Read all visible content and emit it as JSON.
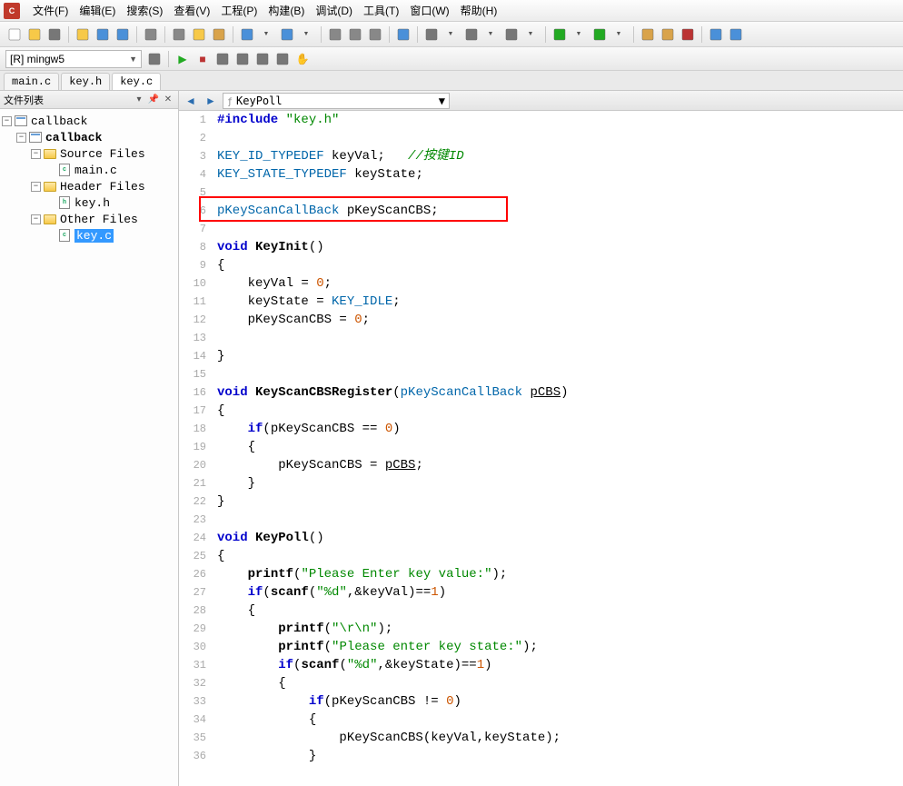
{
  "menu": {
    "items": [
      "文件(F)",
      "编辑(E)",
      "搜索(S)",
      "查看(V)",
      "工程(P)",
      "构建(B)",
      "调试(D)",
      "工具(T)",
      "窗口(W)",
      "帮助(H)"
    ]
  },
  "config_combo": "[R] mingw5",
  "file_tabs": [
    {
      "label": "main.c",
      "active": false
    },
    {
      "label": "key.h",
      "active": false
    },
    {
      "label": "key.c",
      "active": true
    }
  ],
  "side_panel_title": "文件列表",
  "tree": {
    "root": "callback",
    "project": "callback",
    "folders": [
      {
        "name": "Source Files",
        "files": [
          {
            "name": "main.c",
            "ext": "c"
          }
        ]
      },
      {
        "name": "Header Files",
        "files": [
          {
            "name": "key.h",
            "ext": "h"
          }
        ]
      },
      {
        "name": "Other Files",
        "files": [
          {
            "name": "key.c",
            "ext": "c",
            "selected": true
          }
        ]
      }
    ]
  },
  "function_combo": "KeyPoll",
  "highlight_line": 6,
  "code_lines": [
    {
      "n": 1,
      "seg": [
        {
          "t": "#include ",
          "c": "kw"
        },
        {
          "t": "\"key.h\"",
          "c": "str"
        }
      ]
    },
    {
      "n": 2,
      "seg": []
    },
    {
      "n": 3,
      "seg": [
        {
          "t": "KEY_ID_TYPEDEF",
          "c": "ty"
        },
        {
          "t": " keyVal;   ",
          "c": "op"
        },
        {
          "t": "//按键ID",
          "c": "cm"
        }
      ]
    },
    {
      "n": 4,
      "seg": [
        {
          "t": "KEY_STATE_TYPEDEF",
          "c": "ty"
        },
        {
          "t": " keyState;",
          "c": "op"
        }
      ]
    },
    {
      "n": 5,
      "seg": []
    },
    {
      "n": 6,
      "seg": [
        {
          "t": "pKeyScanCallBack",
          "c": "ty"
        },
        {
          "t": " pKeyScanCBS;",
          "c": "op"
        }
      ]
    },
    {
      "n": 7,
      "seg": []
    },
    {
      "n": 8,
      "seg": [
        {
          "t": "void ",
          "c": "kw"
        },
        {
          "t": "KeyInit",
          "c": "fn"
        },
        {
          "t": "()",
          "c": "op"
        }
      ]
    },
    {
      "n": 9,
      "seg": [
        {
          "t": "{",
          "c": "op"
        }
      ]
    },
    {
      "n": 10,
      "seg": [
        {
          "t": "    keyVal = ",
          "c": "op"
        },
        {
          "t": "0",
          "c": "num"
        },
        {
          "t": ";",
          "c": "op"
        }
      ]
    },
    {
      "n": 11,
      "seg": [
        {
          "t": "    keyState = ",
          "c": "op"
        },
        {
          "t": "KEY_IDLE",
          "c": "ty"
        },
        {
          "t": ";",
          "c": "op"
        }
      ]
    },
    {
      "n": 12,
      "seg": [
        {
          "t": "    pKeyScanCBS = ",
          "c": "op"
        },
        {
          "t": "0",
          "c": "num"
        },
        {
          "t": ";",
          "c": "op"
        }
      ]
    },
    {
      "n": 13,
      "seg": []
    },
    {
      "n": 14,
      "seg": [
        {
          "t": "}",
          "c": "op"
        }
      ]
    },
    {
      "n": 15,
      "seg": []
    },
    {
      "n": 16,
      "seg": [
        {
          "t": "void ",
          "c": "kw"
        },
        {
          "t": "KeyScanCBSRegister",
          "c": "fn"
        },
        {
          "t": "(",
          "c": "op"
        },
        {
          "t": "pKeyScanCallBack",
          "c": "ty"
        },
        {
          "t": " ",
          "c": "op"
        },
        {
          "t": "pCBS",
          "c": "und"
        },
        {
          "t": ")",
          "c": "op"
        }
      ]
    },
    {
      "n": 17,
      "seg": [
        {
          "t": "{",
          "c": "op"
        }
      ]
    },
    {
      "n": 18,
      "seg": [
        {
          "t": "    ",
          "c": "op"
        },
        {
          "t": "if",
          "c": "kw"
        },
        {
          "t": "(pKeyScanCBS == ",
          "c": "op"
        },
        {
          "t": "0",
          "c": "num"
        },
        {
          "t": ")",
          "c": "op"
        }
      ]
    },
    {
      "n": 19,
      "seg": [
        {
          "t": "    {",
          "c": "op"
        }
      ]
    },
    {
      "n": 20,
      "seg": [
        {
          "t": "        pKeyScanCBS = ",
          "c": "op"
        },
        {
          "t": "pCBS",
          "c": "und"
        },
        {
          "t": ";",
          "c": "op"
        }
      ]
    },
    {
      "n": 21,
      "seg": [
        {
          "t": "    }",
          "c": "op"
        }
      ]
    },
    {
      "n": 22,
      "seg": [
        {
          "t": "}",
          "c": "op"
        }
      ]
    },
    {
      "n": 23,
      "seg": []
    },
    {
      "n": 24,
      "seg": [
        {
          "t": "void ",
          "c": "kw"
        },
        {
          "t": "KeyPoll",
          "c": "fn"
        },
        {
          "t": "()",
          "c": "op"
        }
      ]
    },
    {
      "n": 25,
      "seg": [
        {
          "t": "{",
          "c": "op"
        }
      ]
    },
    {
      "n": 26,
      "seg": [
        {
          "t": "    ",
          "c": "op"
        },
        {
          "t": "printf",
          "c": "fn"
        },
        {
          "t": "(",
          "c": "op"
        },
        {
          "t": "\"Please Enter key value:\"",
          "c": "str"
        },
        {
          "t": ");",
          "c": "op"
        }
      ]
    },
    {
      "n": 27,
      "seg": [
        {
          "t": "    ",
          "c": "op"
        },
        {
          "t": "if",
          "c": "kw"
        },
        {
          "t": "(",
          "c": "op"
        },
        {
          "t": "scanf",
          "c": "fn"
        },
        {
          "t": "(",
          "c": "op"
        },
        {
          "t": "\"%d\"",
          "c": "str"
        },
        {
          "t": ",&keyVal)==",
          "c": "op"
        },
        {
          "t": "1",
          "c": "num"
        },
        {
          "t": ")",
          "c": "op"
        }
      ]
    },
    {
      "n": 28,
      "seg": [
        {
          "t": "    {",
          "c": "op"
        }
      ]
    },
    {
      "n": 29,
      "seg": [
        {
          "t": "        ",
          "c": "op"
        },
        {
          "t": "printf",
          "c": "fn"
        },
        {
          "t": "(",
          "c": "op"
        },
        {
          "t": "\"\\r\\n\"",
          "c": "str"
        },
        {
          "t": ");",
          "c": "op"
        }
      ]
    },
    {
      "n": 30,
      "seg": [
        {
          "t": "        ",
          "c": "op"
        },
        {
          "t": "printf",
          "c": "fn"
        },
        {
          "t": "(",
          "c": "op"
        },
        {
          "t": "\"Please enter key state:\"",
          "c": "str"
        },
        {
          "t": ");",
          "c": "op"
        }
      ]
    },
    {
      "n": 31,
      "seg": [
        {
          "t": "        ",
          "c": "op"
        },
        {
          "t": "if",
          "c": "kw"
        },
        {
          "t": "(",
          "c": "op"
        },
        {
          "t": "scanf",
          "c": "fn"
        },
        {
          "t": "(",
          "c": "op"
        },
        {
          "t": "\"%d\"",
          "c": "str"
        },
        {
          "t": ",&keyState)==",
          "c": "op"
        },
        {
          "t": "1",
          "c": "num"
        },
        {
          "t": ")",
          "c": "op"
        }
      ]
    },
    {
      "n": 32,
      "seg": [
        {
          "t": "        {",
          "c": "op"
        }
      ]
    },
    {
      "n": 33,
      "seg": [
        {
          "t": "            ",
          "c": "op"
        },
        {
          "t": "if",
          "c": "kw"
        },
        {
          "t": "(pKeyScanCBS != ",
          "c": "op"
        },
        {
          "t": "0",
          "c": "num"
        },
        {
          "t": ")",
          "c": "op"
        }
      ]
    },
    {
      "n": 34,
      "seg": [
        {
          "t": "            {",
          "c": "op"
        }
      ]
    },
    {
      "n": 35,
      "seg": [
        {
          "t": "                pKeyScanCBS(keyVal,keyState);",
          "c": "op"
        }
      ]
    },
    {
      "n": 36,
      "seg": [
        {
          "t": "            }",
          "c": "op"
        }
      ]
    }
  ],
  "toolbar_icons": [
    "new-file",
    "open",
    "open-dropdown",
    "sep",
    "copy",
    "save",
    "save-all",
    "sep",
    "print",
    "sep",
    "cut",
    "copy2",
    "paste",
    "sep",
    "undo",
    "undo-dd",
    "redo",
    "redo-dd",
    "sep",
    "find",
    "find-next",
    "replace",
    "sep",
    "bookmark",
    "sep",
    "tool-a",
    "tool-a-dd",
    "tool-b",
    "tool-b-dd",
    "tool-c",
    "tool-c-dd",
    "sep",
    "back",
    "back-dd",
    "forward",
    "forward-dd",
    "sep",
    "export",
    "export2",
    "stop-export",
    "sep",
    "help",
    "info"
  ],
  "toolbar2_icons": [
    "cfg",
    "sep",
    "run",
    "stop",
    "step-over",
    "step-into",
    "step-out",
    "breakpoint",
    "hand"
  ],
  "colors": {
    "keyword": "#0000cc",
    "type": "#0066aa",
    "string": "#008800",
    "number": "#cc5500",
    "comment": "#008800",
    "highlight_border": "#ff0000",
    "selection": "#3399ff"
  }
}
